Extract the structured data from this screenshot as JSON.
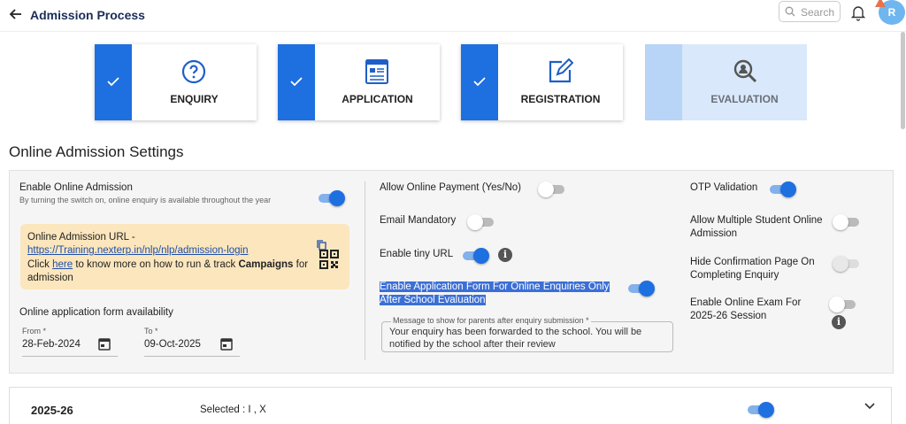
{
  "header": {
    "title": "Admission Process",
    "search_placeholder": "Search",
    "avatar_initial": "R"
  },
  "steps": [
    {
      "label": "ENQUIRY",
      "icon": "question-circle-icon",
      "done": true
    },
    {
      "label": "APPLICATION",
      "icon": "form-icon",
      "done": true
    },
    {
      "label": "REGISTRATION",
      "icon": "edit-icon",
      "done": true
    },
    {
      "label": "EVALUATION",
      "icon": "search-user-icon",
      "done": false
    }
  ],
  "section_title": "Online Admission Settings",
  "left": {
    "enable_online": {
      "label": "Enable Online Admission",
      "sub": "By turning the switch on, online enquiry is available throughout the year",
      "on": true
    },
    "url_box": {
      "title": "Online Admission URL -",
      "url": "https://Training.nexterp.in/nlp/nlp/admission-login",
      "click": "Click",
      "here": "here",
      "rest": " to know more on how to run & track ",
      "campaigns": "Campaigns",
      "rest2": " for admission"
    },
    "availability_label": "Online application form availability",
    "from": {
      "label": "From *",
      "value": "28-Feb-2024"
    },
    "to": {
      "label": "To *",
      "value": "09-Oct-2025"
    }
  },
  "middle": {
    "allow_payment": {
      "label": "Allow Online Payment (Yes/No)",
      "on": false
    },
    "email_mandatory": {
      "label": "Email Mandatory",
      "on": false
    },
    "tiny_url": {
      "label": "Enable tiny URL",
      "on": true
    },
    "app_form": {
      "line1": "Enable Application Form For Online Enquiries Only",
      "line2": "After School Evaluation",
      "on": true
    },
    "message": {
      "label": "Message to show for parents after enquiry submission *",
      "value": "Your enquiry has been forwarded to the school. You will be notified by the school after their review"
    }
  },
  "right": {
    "otp": {
      "label": "OTP Validation",
      "on": true
    },
    "multiple": {
      "line1": "Allow Multiple Student Online",
      "line2": "Admission",
      "on": false
    },
    "hide_conf": {
      "line1": "Hide Confirmation Page On",
      "line2": "Completing Enquiry",
      "on": false
    },
    "online_exam": {
      "line1": "Enable Online Exam For",
      "line2": "2025-26 Session",
      "on": false
    }
  },
  "session": {
    "year": "2025-26",
    "selected": "Selected : I , X",
    "on": true
  },
  "colors": {
    "primary": "#1e6fe0",
    "url_box": "#fbe6bd",
    "title": "#1b2d57"
  }
}
